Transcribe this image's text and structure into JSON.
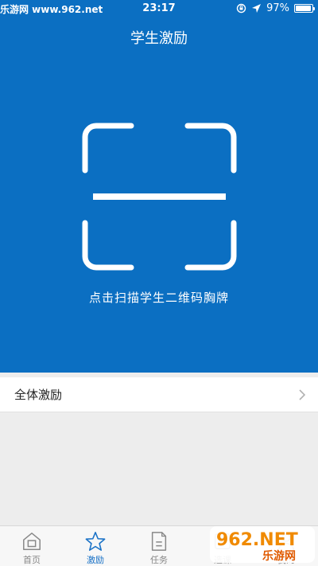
{
  "status_bar": {
    "watermark": "乐游网 www.962.net",
    "time": "23:17",
    "battery_percent": "97%",
    "battery_level": 0.97
  },
  "header": {
    "title": "学生激励"
  },
  "scanner": {
    "hint": "点击扫描学生二维码胸牌"
  },
  "list": {
    "items": [
      {
        "label": "全体激励"
      }
    ]
  },
  "tabbar": {
    "tabs": [
      {
        "label": "首页",
        "icon": "home-icon",
        "active": false
      },
      {
        "label": "激励",
        "icon": "star-icon",
        "active": true
      },
      {
        "label": "任务",
        "icon": "document-icon",
        "active": false
      },
      {
        "label": "选课",
        "icon": "course-icon",
        "active": false
      },
      {
        "label": "我的",
        "icon": "user-icon",
        "active": false
      }
    ]
  },
  "logo": {
    "text": "962.NET",
    "subtext": "乐游网"
  },
  "colors": {
    "primary": "#0b6fc2",
    "active_tab": "#1a72c7",
    "background": "#ededed"
  }
}
